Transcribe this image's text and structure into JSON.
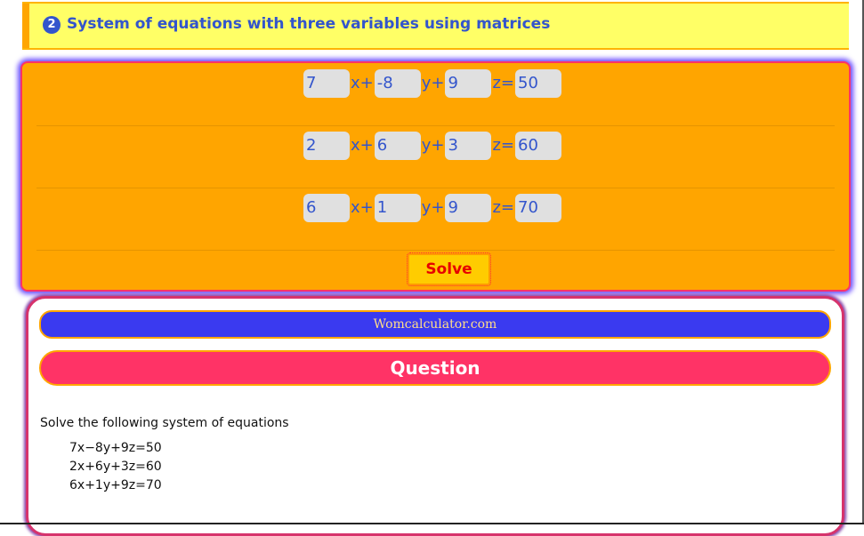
{
  "header": {
    "number": "2",
    "title": "System of equations with three variables using matrices"
  },
  "inputs": {
    "rows": [
      {
        "a": "7",
        "b": "-8",
        "c": "9",
        "d": "50"
      },
      {
        "a": "2",
        "b": "6",
        "c": "3",
        "d": "60"
      },
      {
        "a": "6",
        "b": "1",
        "c": "9",
        "d": "70"
      }
    ],
    "op_x": "x+",
    "op_y": "y+",
    "op_z": "z=",
    "solve_label": "Solve"
  },
  "result": {
    "site": "Womcalculator.com",
    "question_heading": "Question",
    "prompt": "Solve the following system of equations",
    "equations": [
      "7x−8y+9z=50",
      "2x+6y+3z=60",
      "6x+1y+9z=70"
    ]
  },
  "colors": {
    "header_bg": "#ffff66",
    "accent_blue": "#3355cc",
    "panel_orange": "#ffa500",
    "question_pink": "#ff3366",
    "site_blue": "#3a3af0",
    "solve_yellow": "#ffcc00",
    "solve_red": "#e60000"
  }
}
